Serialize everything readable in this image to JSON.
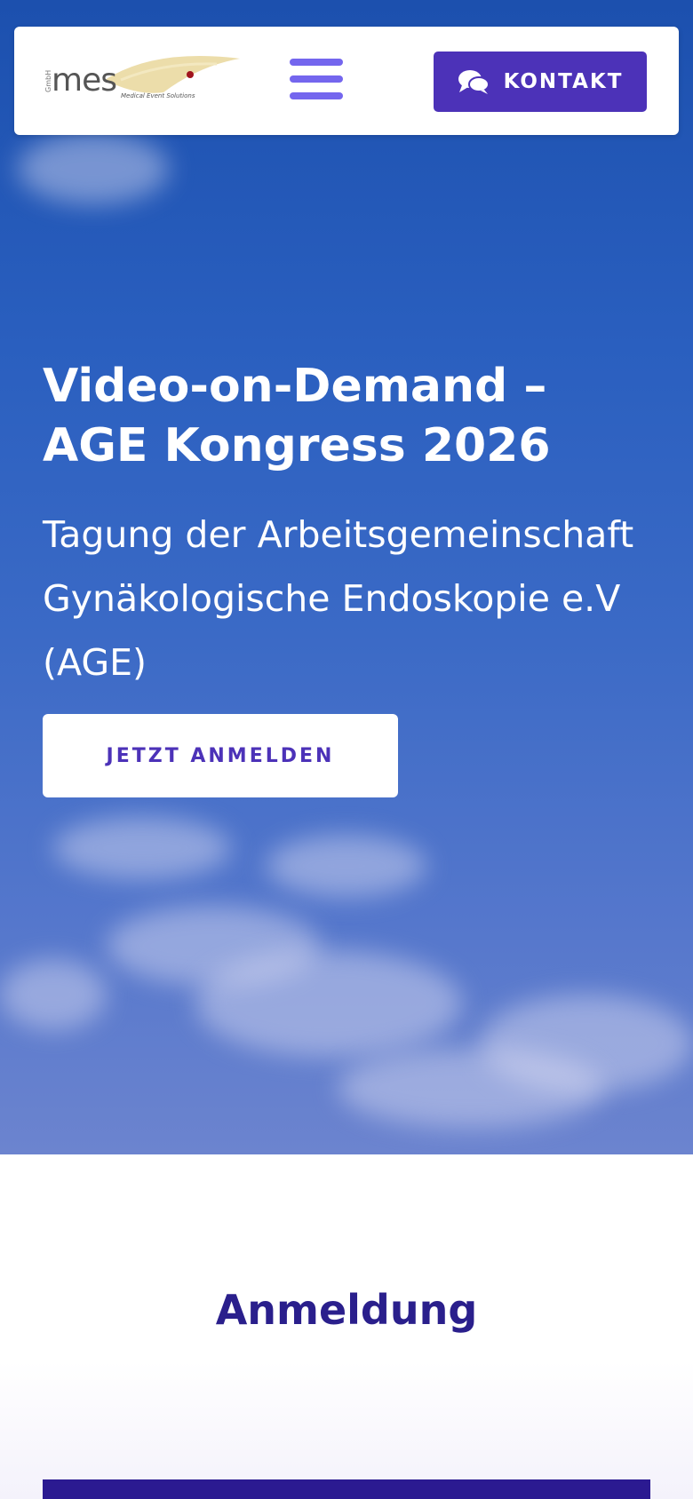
{
  "header": {
    "logo": {
      "gmbh": "GmbH",
      "name": "mes",
      "tagline": "Medical Event Solutions"
    },
    "menu_icon": "hamburger-menu-icon",
    "contact_button": {
      "icon": "chat-bubbles-icon",
      "label": "KONTAKT"
    }
  },
  "hero": {
    "title": "Video-on-Demand – AGE Kongress 2026",
    "subtitle": "Tagung der Arbeitsgemeinschaft Gynäkologische Endoskopie e.V (AGE)",
    "cta_label": "JETZT ANMELDEN"
  },
  "section": {
    "title": "Anmeldung"
  },
  "colors": {
    "accent": "#4c32b8",
    "menu_icon": "#7466ee",
    "section_title": "#2a1f8c",
    "sky": "#2a5fbf",
    "logo_swoosh": "#e9d79b",
    "logo_dot": "#a0141e"
  }
}
